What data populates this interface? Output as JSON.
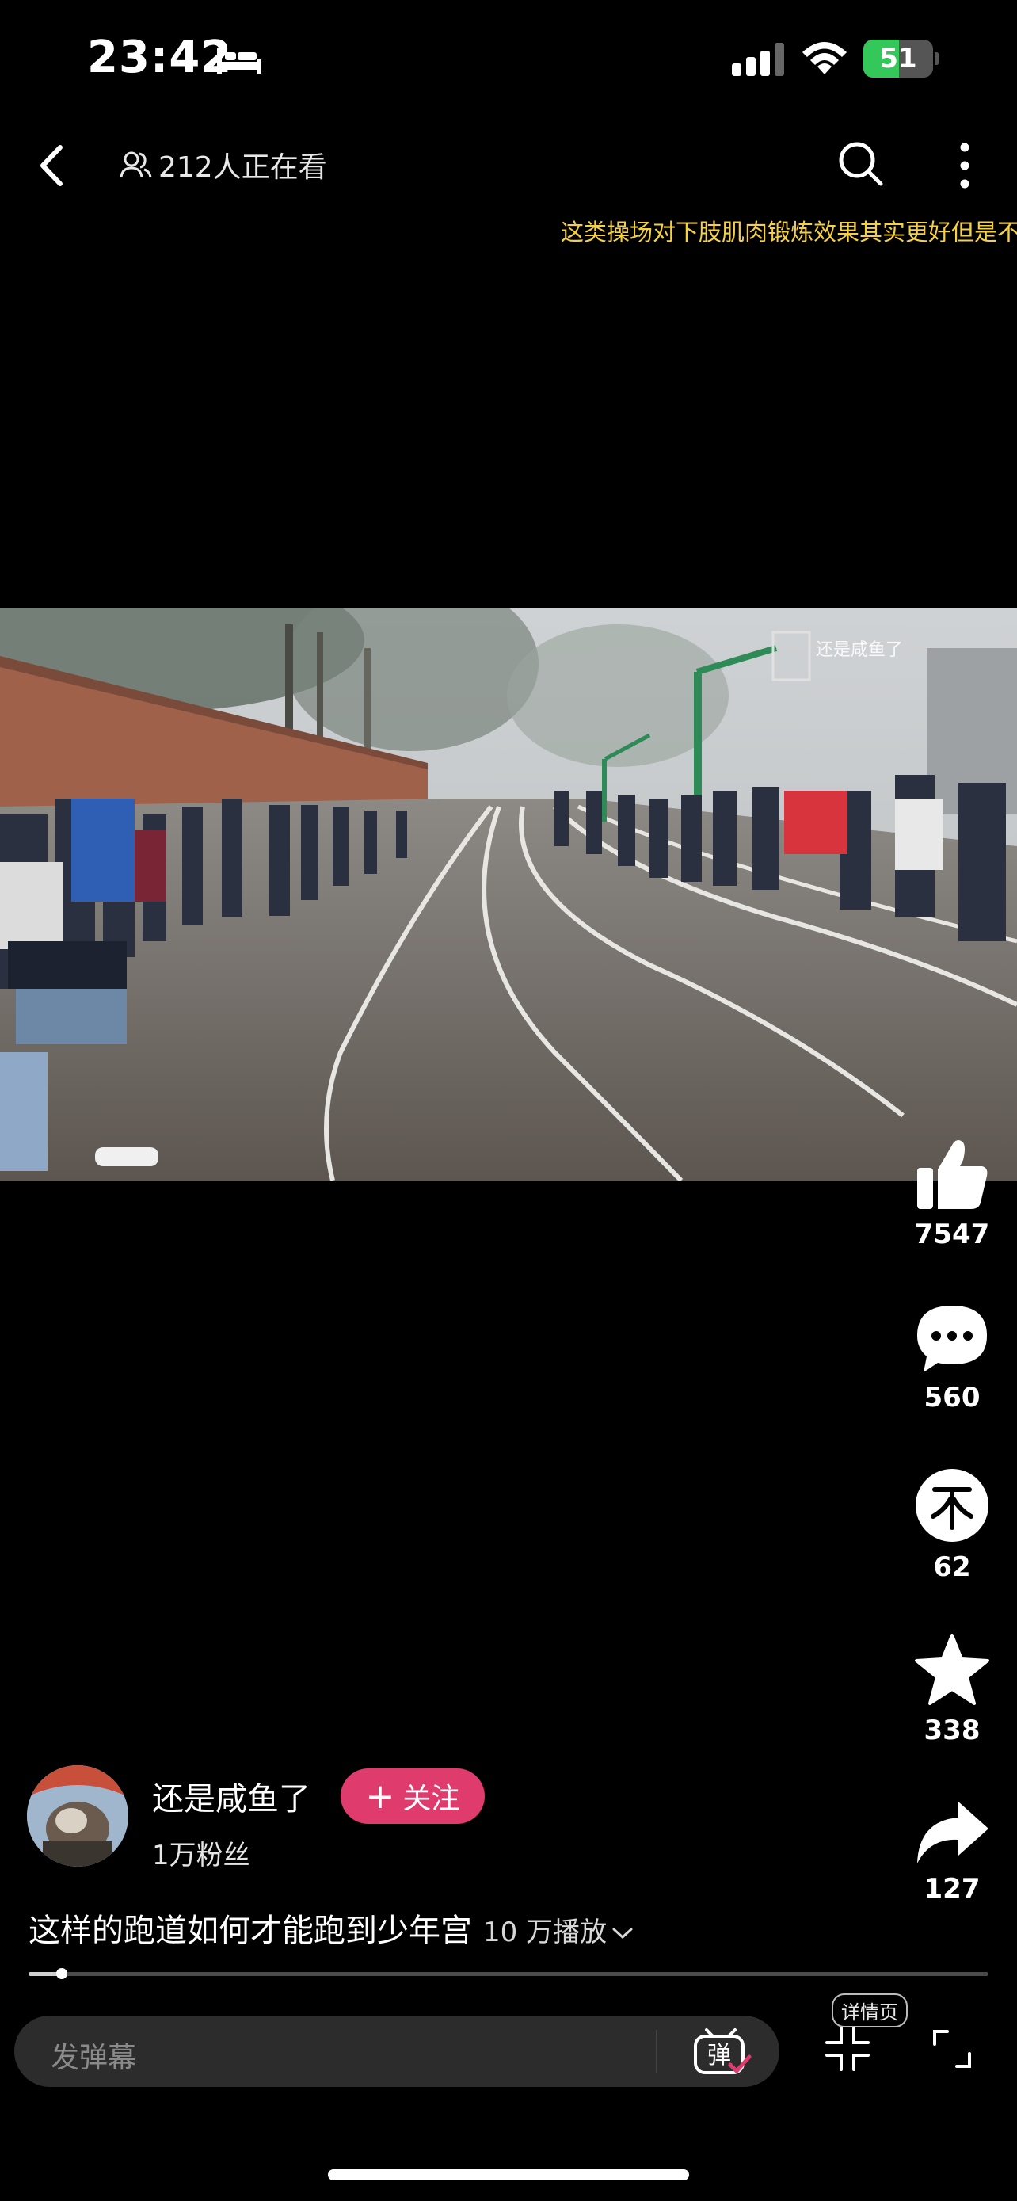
{
  "status_bar": {
    "time": "23:42",
    "battery": "51",
    "battery_level": 0.51,
    "icons": [
      "bed-icon",
      "cellular-signal-icon",
      "wifi-icon",
      "battery-charging-icon"
    ]
  },
  "top_nav": {
    "viewers": "212人正在看",
    "icons": [
      "back-arrow-icon",
      "people-icon",
      "search-icon",
      "more-vertical-icon"
    ]
  },
  "ticker": "这类操场对下肢肌肉锻炼效果其实更好但是不",
  "video": {
    "watermark": "还是咸鱼了"
  },
  "actions": {
    "like": {
      "icon": "thumbs-up-icon",
      "count": "7547"
    },
    "comment": {
      "icon": "comment-bubble-icon",
      "count": "560"
    },
    "coin": {
      "icon": "coin-icon",
      "count": "62"
    },
    "favorite": {
      "icon": "star-icon",
      "count": "338"
    },
    "share": {
      "icon": "share-arrow-icon",
      "count": "127"
    }
  },
  "author": {
    "name": "还是咸鱼了",
    "follow_label": "关注",
    "followers": "1万粉丝"
  },
  "caption": {
    "title": "这样的跑道如何才能跑到少年宫",
    "plays": "10 万播放"
  },
  "playback": {
    "progress": 0.035
  },
  "bottom_bar": {
    "danmaku_placeholder": "发弹幕",
    "danmaku_icon_text": "弹",
    "detail_label": "详情页"
  },
  "colors": {
    "follow_button": "#e03b6d",
    "ticker_text": "#f5d142",
    "battery": "#34c759"
  }
}
